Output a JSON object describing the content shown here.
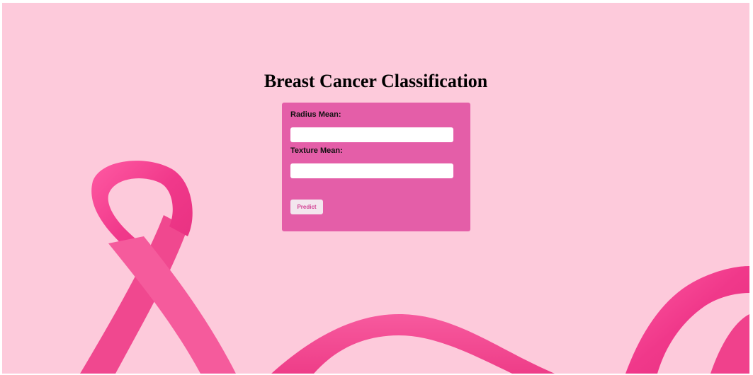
{
  "page": {
    "title": "Breast Cancer Classification"
  },
  "form": {
    "fields": [
      {
        "label": "Radius Mean:",
        "value": "",
        "placeholder": ""
      },
      {
        "label": "Texture Mean:",
        "value": "",
        "placeholder": ""
      }
    ],
    "submit_label": "Predict"
  },
  "colors": {
    "background": "#fdcadb",
    "card": "#e45ea8",
    "ribbon": "#f2418f",
    "button_text": "#d23f93"
  },
  "background_image": "pink-awareness-ribbon"
}
